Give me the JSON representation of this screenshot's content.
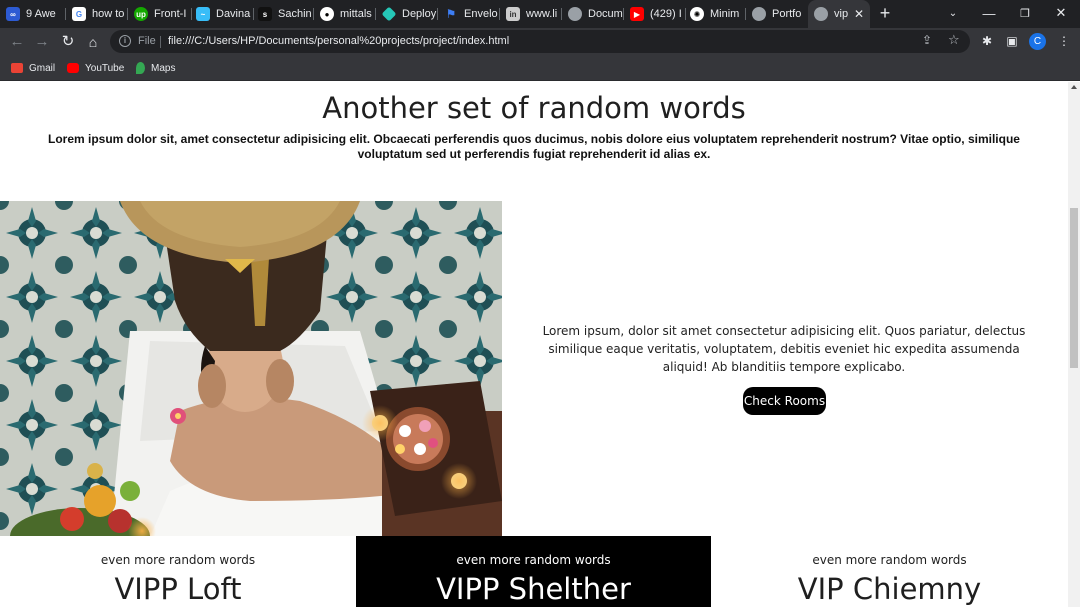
{
  "browser": {
    "tabs": [
      {
        "title": "9 Awe",
        "fav": "infinity-icon",
        "color": "#4b7bec"
      },
      {
        "title": "how to",
        "fav": "google-icon",
        "color": "#ffffff"
      },
      {
        "title": "Front-I",
        "fav": "upwork-icon",
        "color": "#14a800"
      },
      {
        "title": "Davina",
        "fav": "tailwind-icon",
        "color": "#38bdf8"
      },
      {
        "title": "Sachin",
        "fav": "sachin-icon",
        "color": "#111111"
      },
      {
        "title": "mittals",
        "fav": "github-icon",
        "color": "#ffffff"
      },
      {
        "title": "Deploy",
        "fav": "netlify-icon",
        "color": "#25c7b7"
      },
      {
        "title": "Envelo",
        "fav": "flag-icon",
        "color": "#3d7ef5"
      },
      {
        "title": "www.li",
        "fav": "linkedin-icon",
        "color": "#cccccc"
      },
      {
        "title": "Docum",
        "fav": "globe-icon",
        "color": "#9aa0a6"
      },
      {
        "title": "(429) I",
        "fav": "youtube-icon",
        "color": "#ff0000"
      },
      {
        "title": "Minim",
        "fav": "chatgpt-icon",
        "color": "#ffffff"
      },
      {
        "title": "Portfo",
        "fav": "globe-icon",
        "color": "#9aa0a6"
      },
      {
        "title": "vip",
        "fav": "globe-icon",
        "color": "#9aa0a6"
      }
    ],
    "new_tab": "+",
    "address": {
      "scheme_label": "File",
      "url": "file:///C:/Users/HP/Documents/personal%20projects/project/index.html"
    },
    "profile_initial": "C",
    "bookmarks": [
      {
        "label": "Gmail",
        "color": "#ea4335"
      },
      {
        "label": "YouTube",
        "color": "#ff0000"
      },
      {
        "label": "Maps",
        "color": "#34a853"
      }
    ]
  },
  "page": {
    "heading": "Another set of random words",
    "intro": "Lorem ipsum dolor sit, amet consectetur adipisicing elit. Obcaecati perferendis quos ducimus, nobis dolore eius voluptatem reprehenderit nostrum? Vitae optio, similique voluptatum sed ut perferendis fugiat reprehenderit id alias ex.",
    "feature": {
      "text": "Lorem ipsum, dolor sit amet consectetur adipisicing elit. Quos pariatur, delectus similique eaque veritatis, voluptatem, debitis eveniet hic expedita assumenda aliquid! Ab blanditiis tempore explicabo.",
      "button": "Check Rooms"
    },
    "rooms": [
      {
        "subtitle": "even more random words",
        "name": "VIPP Loft",
        "theme": "light"
      },
      {
        "subtitle": "even more random words",
        "name": "VIPP Shelther",
        "theme": "dark"
      },
      {
        "subtitle": "even more random words",
        "name": "VIP Chiemny",
        "theme": "light"
      }
    ]
  }
}
